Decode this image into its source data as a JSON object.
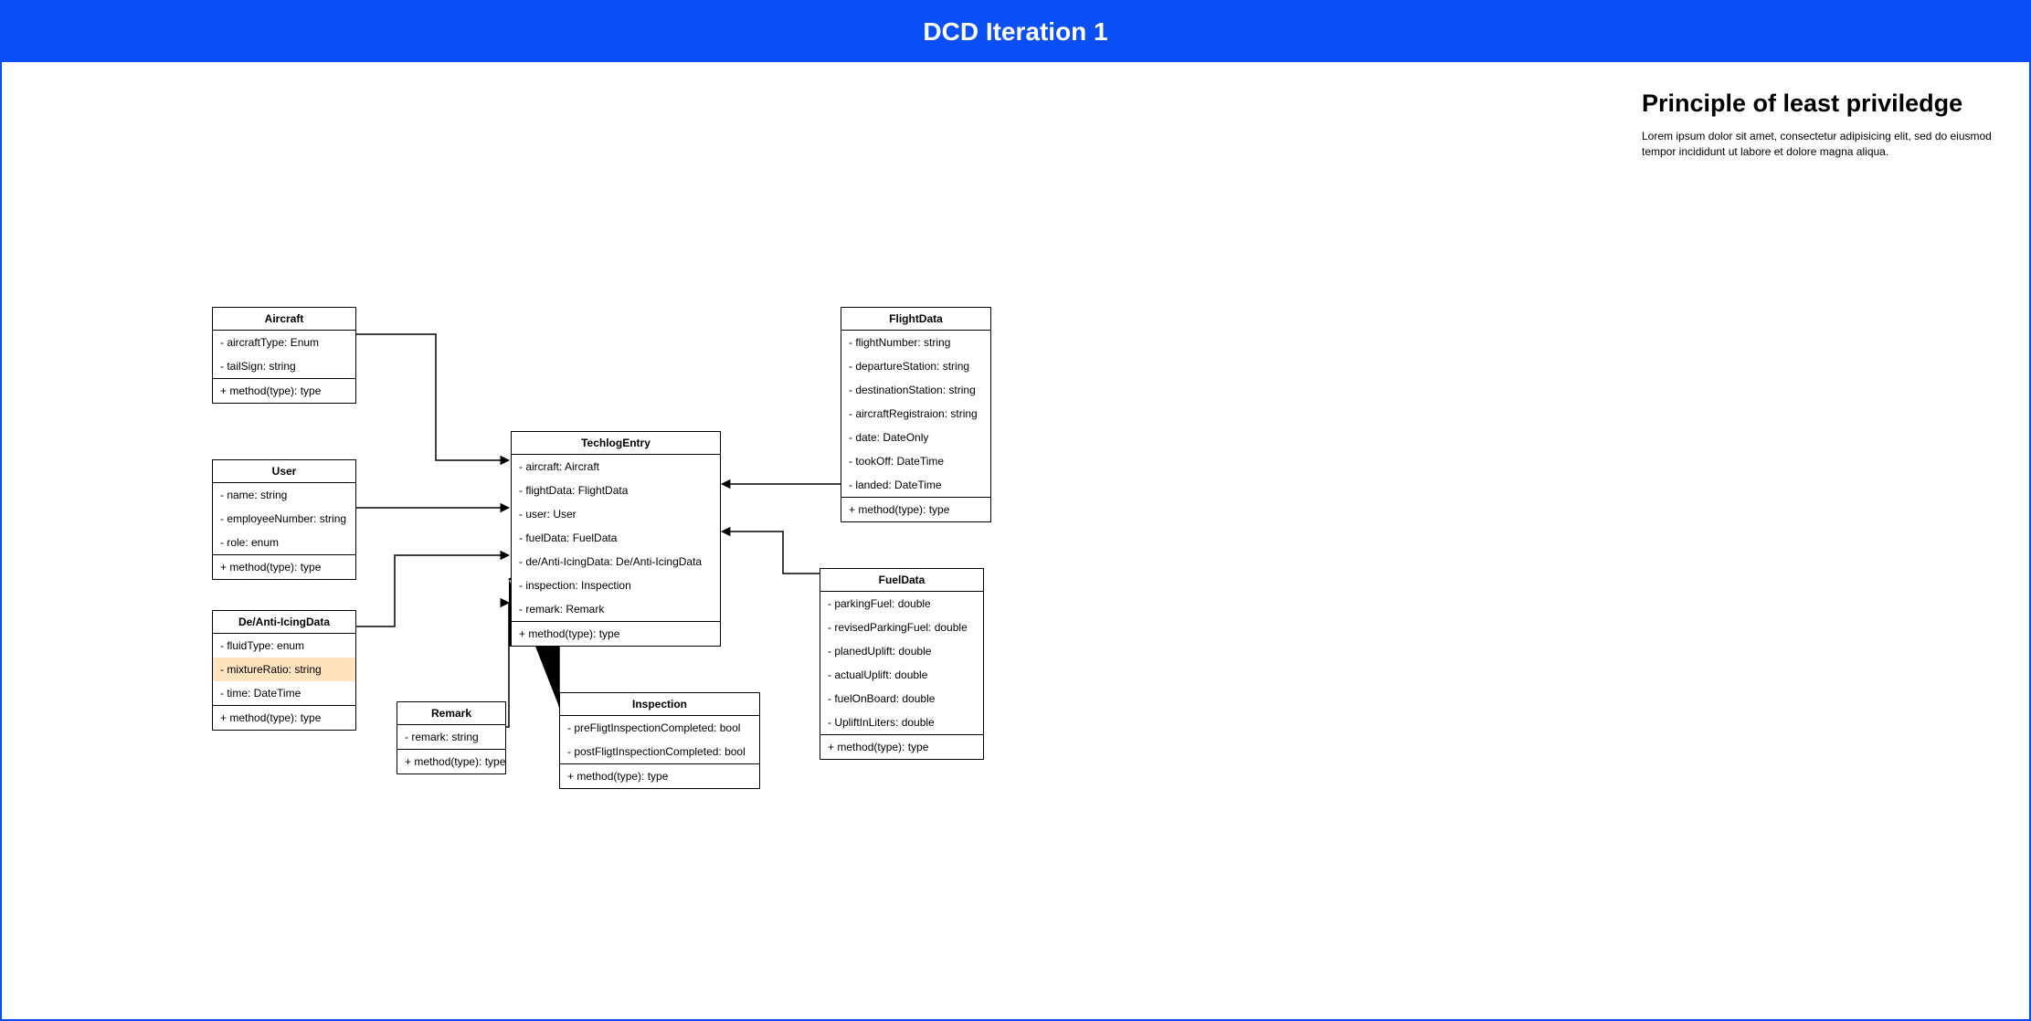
{
  "header": {
    "title": "DCD Iteration 1"
  },
  "sidebar": {
    "heading": "Principle of least priviledge",
    "body": "Lorem ipsum dolor sit amet, consectetur adipisicing elit, sed do eiusmod tempor incididunt ut labore et dolore magna aliqua."
  },
  "classes": {
    "aircraft": {
      "name": "Aircraft",
      "attrs": [
        "- aircraftType: Enum",
        "- tailSign: string"
      ],
      "methods": [
        "+ method(type): type"
      ]
    },
    "user": {
      "name": "User",
      "attrs": [
        "- name: string",
        "- employeeNumber: string",
        "- role: enum"
      ],
      "methods": [
        "+ method(type): type"
      ]
    },
    "deIcing": {
      "name": "De/Anti-IcingData",
      "attrs": [
        "- fluidType: enum",
        "- mixtureRatio: string",
        "- time: DateTime"
      ],
      "methods": [
        "+ method(type): type"
      ]
    },
    "remark": {
      "name": "Remark",
      "attrs": [
        "- remark: string"
      ],
      "methods": [
        "+ method(type): type"
      ]
    },
    "techlog": {
      "name": "TechlogEntry",
      "attrs": [
        "- aircraft: Aircraft",
        "- flightData: FlightData",
        "- user: User",
        "- fuelData: FuelData",
        "- de/Anti-IcingData: De/Anti-IcingData",
        "- inspection: Inspection",
        "- remark: Remark"
      ],
      "methods": [
        "+ method(type): type"
      ]
    },
    "inspection": {
      "name": "Inspection",
      "attrs": [
        "- preFligtInspectionCompleted: bool",
        "- postFligtInspectionCompleted: bool"
      ],
      "methods": [
        "+ method(type): type"
      ]
    },
    "flightData": {
      "name": "FlightData",
      "attrs": [
        "- flightNumber: string",
        "- departureStation: string",
        "- destinationStation: string",
        "- aircraftRegistraion: string",
        "- date: DateOnly",
        "- tookOff: DateTime",
        "- landed: DateTime"
      ],
      "methods": [
        "+ method(type): type"
      ]
    },
    "fuelData": {
      "name": "FuelData",
      "attrs": [
        "- parkingFuel: double",
        "- revisedParkingFuel: double",
        "- planedUplift: double",
        "- actualUplift: double",
        "- fuelOnBoard: double",
        "- UpliftInLiters: double"
      ],
      "methods": [
        "+ method(type): type"
      ]
    }
  }
}
